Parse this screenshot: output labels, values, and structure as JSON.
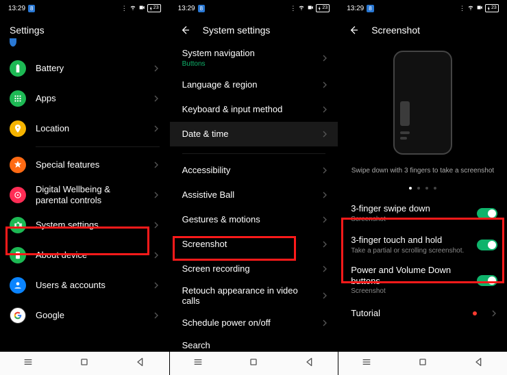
{
  "status": {
    "time": "13:29",
    "badge": "8",
    "battery": "23"
  },
  "screen1": {
    "title": "Settings",
    "items": [
      {
        "label": "Battery",
        "color": "#1db954",
        "icon": "battery"
      },
      {
        "label": "Apps",
        "color": "#1db954",
        "icon": "apps"
      },
      {
        "label": "Location",
        "color": "#f5b400",
        "icon": "location"
      }
    ],
    "items2": [
      {
        "label": "Special features",
        "color": "#ff6a13",
        "icon": "star"
      },
      {
        "label": "Digital Wellbeing & parental controls",
        "color": "#ff2d55",
        "icon": "wellbeing"
      },
      {
        "label": "System settings",
        "color": "#1db954",
        "icon": "gear",
        "highlight": true
      },
      {
        "label": "About device",
        "color": "#1db954",
        "icon": "device"
      },
      {
        "label": "Users & accounts",
        "color": "#0a84ff",
        "icon": "user"
      },
      {
        "label": "Google",
        "color": "#ffffff",
        "icon": "google",
        "ring": true
      }
    ]
  },
  "screen2": {
    "title": "System settings",
    "group1": [
      {
        "label": "System navigation",
        "sub": "Buttons",
        "accent": true
      },
      {
        "label": "Language & region"
      },
      {
        "label": "Keyboard & input method"
      },
      {
        "label": "Date & time",
        "selected": true
      }
    ],
    "group2": [
      {
        "label": "Accessibility"
      },
      {
        "label": "Assistive Ball"
      },
      {
        "label": "Gestures & motions"
      },
      {
        "label": "Screenshot",
        "highlight": true
      },
      {
        "label": "Screen recording"
      },
      {
        "label": "Retouch appearance in video calls"
      },
      {
        "label": "Schedule power on/off"
      },
      {
        "label": "Search"
      }
    ]
  },
  "screen3": {
    "title": "Screenshot",
    "caption": "Swipe down with 3 fingers to take a screenshot",
    "toggles": [
      {
        "label": "3-finger swipe down",
        "sub": "Screenshot"
      },
      {
        "label": "3-finger touch and hold",
        "sub": "Take a partial or scrolling screenshot."
      }
    ],
    "extra": {
      "label": "Power and Volume Down buttons",
      "sub": "Screenshot"
    },
    "tutorial": "Tutorial"
  }
}
